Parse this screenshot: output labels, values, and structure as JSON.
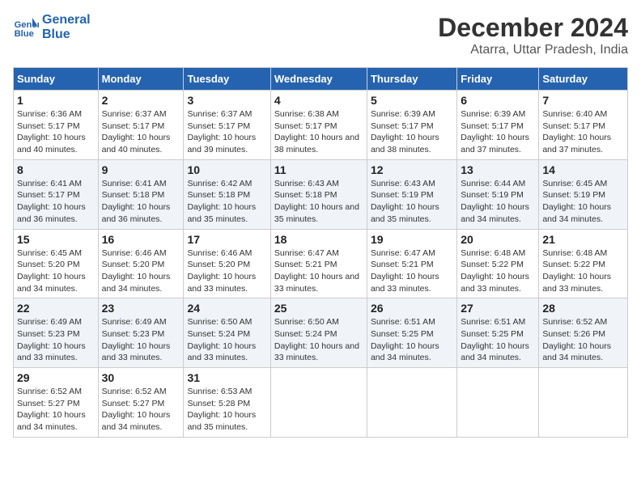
{
  "logo": {
    "line1": "General",
    "line2": "Blue"
  },
  "header": {
    "month": "December 2024",
    "location": "Atarra, Uttar Pradesh, India"
  },
  "weekdays": [
    "Sunday",
    "Monday",
    "Tuesday",
    "Wednesday",
    "Thursday",
    "Friday",
    "Saturday"
  ],
  "weeks": [
    [
      {
        "day": "1",
        "sunrise": "6:36 AM",
        "sunset": "5:17 PM",
        "daylight": "10 hours and 40 minutes."
      },
      {
        "day": "2",
        "sunrise": "6:37 AM",
        "sunset": "5:17 PM",
        "daylight": "10 hours and 40 minutes."
      },
      {
        "day": "3",
        "sunrise": "6:37 AM",
        "sunset": "5:17 PM",
        "daylight": "10 hours and 39 minutes."
      },
      {
        "day": "4",
        "sunrise": "6:38 AM",
        "sunset": "5:17 PM",
        "daylight": "10 hours and 38 minutes."
      },
      {
        "day": "5",
        "sunrise": "6:39 AM",
        "sunset": "5:17 PM",
        "daylight": "10 hours and 38 minutes."
      },
      {
        "day": "6",
        "sunrise": "6:39 AM",
        "sunset": "5:17 PM",
        "daylight": "10 hours and 37 minutes."
      },
      {
        "day": "7",
        "sunrise": "6:40 AM",
        "sunset": "5:17 PM",
        "daylight": "10 hours and 37 minutes."
      }
    ],
    [
      {
        "day": "8",
        "sunrise": "6:41 AM",
        "sunset": "5:17 PM",
        "daylight": "10 hours and 36 minutes."
      },
      {
        "day": "9",
        "sunrise": "6:41 AM",
        "sunset": "5:18 PM",
        "daylight": "10 hours and 36 minutes."
      },
      {
        "day": "10",
        "sunrise": "6:42 AM",
        "sunset": "5:18 PM",
        "daylight": "10 hours and 35 minutes."
      },
      {
        "day": "11",
        "sunrise": "6:43 AM",
        "sunset": "5:18 PM",
        "daylight": "10 hours and 35 minutes."
      },
      {
        "day": "12",
        "sunrise": "6:43 AM",
        "sunset": "5:19 PM",
        "daylight": "10 hours and 35 minutes."
      },
      {
        "day": "13",
        "sunrise": "6:44 AM",
        "sunset": "5:19 PM",
        "daylight": "10 hours and 34 minutes."
      },
      {
        "day": "14",
        "sunrise": "6:45 AM",
        "sunset": "5:19 PM",
        "daylight": "10 hours and 34 minutes."
      }
    ],
    [
      {
        "day": "15",
        "sunrise": "6:45 AM",
        "sunset": "5:20 PM",
        "daylight": "10 hours and 34 minutes."
      },
      {
        "day": "16",
        "sunrise": "6:46 AM",
        "sunset": "5:20 PM",
        "daylight": "10 hours and 34 minutes."
      },
      {
        "day": "17",
        "sunrise": "6:46 AM",
        "sunset": "5:20 PM",
        "daylight": "10 hours and 33 minutes."
      },
      {
        "day": "18",
        "sunrise": "6:47 AM",
        "sunset": "5:21 PM",
        "daylight": "10 hours and 33 minutes."
      },
      {
        "day": "19",
        "sunrise": "6:47 AM",
        "sunset": "5:21 PM",
        "daylight": "10 hours and 33 minutes."
      },
      {
        "day": "20",
        "sunrise": "6:48 AM",
        "sunset": "5:22 PM",
        "daylight": "10 hours and 33 minutes."
      },
      {
        "day": "21",
        "sunrise": "6:48 AM",
        "sunset": "5:22 PM",
        "daylight": "10 hours and 33 minutes."
      }
    ],
    [
      {
        "day": "22",
        "sunrise": "6:49 AM",
        "sunset": "5:23 PM",
        "daylight": "10 hours and 33 minutes."
      },
      {
        "day": "23",
        "sunrise": "6:49 AM",
        "sunset": "5:23 PM",
        "daylight": "10 hours and 33 minutes."
      },
      {
        "day": "24",
        "sunrise": "6:50 AM",
        "sunset": "5:24 PM",
        "daylight": "10 hours and 33 minutes."
      },
      {
        "day": "25",
        "sunrise": "6:50 AM",
        "sunset": "5:24 PM",
        "daylight": "10 hours and 33 minutes."
      },
      {
        "day": "26",
        "sunrise": "6:51 AM",
        "sunset": "5:25 PM",
        "daylight": "10 hours and 34 minutes."
      },
      {
        "day": "27",
        "sunrise": "6:51 AM",
        "sunset": "5:25 PM",
        "daylight": "10 hours and 34 minutes."
      },
      {
        "day": "28",
        "sunrise": "6:52 AM",
        "sunset": "5:26 PM",
        "daylight": "10 hours and 34 minutes."
      }
    ],
    [
      {
        "day": "29",
        "sunrise": "6:52 AM",
        "sunset": "5:27 PM",
        "daylight": "10 hours and 34 minutes."
      },
      {
        "day": "30",
        "sunrise": "6:52 AM",
        "sunset": "5:27 PM",
        "daylight": "10 hours and 34 minutes."
      },
      {
        "day": "31",
        "sunrise": "6:53 AM",
        "sunset": "5:28 PM",
        "daylight": "10 hours and 35 minutes."
      },
      null,
      null,
      null,
      null
    ]
  ]
}
